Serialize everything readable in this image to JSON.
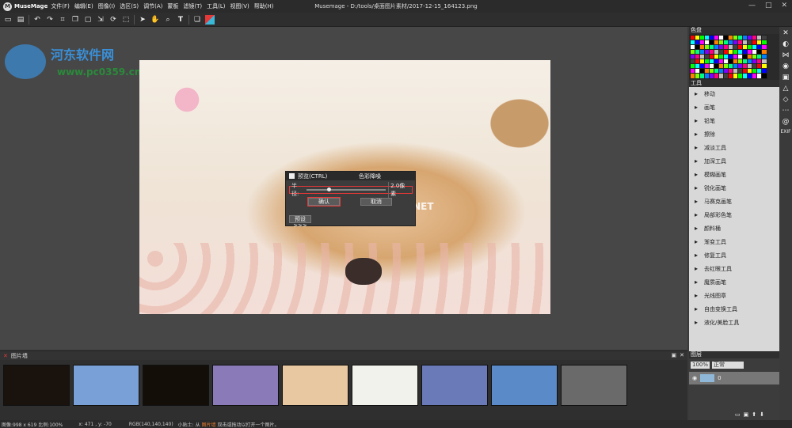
{
  "app": {
    "name": "MuseMage",
    "window_title": "Musemage - D:/tools/桌面图片素材/2017-12-15_164123.png"
  },
  "menu": [
    "文件(F)",
    "编辑(E)",
    "图像(I)",
    "选区(S)",
    "调节(A)",
    "蒙板",
    "滤镜(T)",
    "工具(L)",
    "视图(V)",
    "帮助(H)"
  ],
  "window_buttons": [
    "—",
    "□",
    "✕"
  ],
  "toolbar_icons": [
    "new-icon",
    "open-icon",
    "undo-icon",
    "redo-icon",
    "crop-icon",
    "copy-icon",
    "paste-icon",
    "resize-icon",
    "rotate-icon",
    "select-icon",
    "pointer-icon",
    "hand-icon",
    "zoom-icon",
    "text-icon",
    "layers-icon",
    "color-icon"
  ],
  "watermarks": {
    "site_cn": "河东软件网",
    "site_url": "www.pc0359.cn",
    "photo_mark": "www.pHome.NET"
  },
  "dialog": {
    "preview_label": "预览(CTRL)",
    "title": "色彩降噪",
    "radius_label": "半径:",
    "radius_value": "2.0像素",
    "ok_label": "确认",
    "cancel_label": "取消",
    "preset_label": "预设>>>",
    "slider_fraction": 0.27
  },
  "filmstrip": {
    "title": "图片墙",
    "thumb_colors": [
      "#1a120c",
      "#7aa0d8",
      "#140e08",
      "#8a7ab8",
      "#e8c8a0",
      "#f2f2ec",
      "#6a7ab8",
      "#5a8ac8",
      "#6a6a6a"
    ]
  },
  "status": {
    "size": "图像:998 x 619 比例:100%",
    "coords": "x: 471 , y: -70",
    "rgb": "RGB(140,140,140)",
    "tip_prefix": "小贴士: 从 ",
    "tip_link": "图片墙",
    "tip_suffix": " 双击或拖动以打开一个图片。"
  },
  "panels": {
    "palette_title": "色盘",
    "tools_title": "工具",
    "layers_title": "图层"
  },
  "palette": [
    "#ff0000",
    "#ffff00",
    "#00ff00",
    "#00ffff",
    "#0000ff",
    "#ff00ff",
    "#ffffff",
    "#000000",
    "#ff8000",
    "#80ff00",
    "#00ff80",
    "#0080ff",
    "#8000ff",
    "#ff0080",
    "#c0c0c0",
    "#404040"
  ],
  "tools": [
    {
      "icon": "arrow-icon",
      "label": "移动"
    },
    {
      "icon": "brush-icon",
      "label": "画笔"
    },
    {
      "icon": "pencil-icon",
      "label": "铅笔"
    },
    {
      "icon": "eraser-icon",
      "label": "擦除"
    },
    {
      "icon": "dodge-icon",
      "label": "减淡工具"
    },
    {
      "icon": "burn-icon",
      "label": "加深工具"
    },
    {
      "icon": "blur-icon",
      "label": "模糊画笔"
    },
    {
      "icon": "sharpen-icon",
      "label": "锐化画笔"
    },
    {
      "icon": "mosaic-icon",
      "label": "马赛克画笔"
    },
    {
      "icon": "color-brush-icon",
      "label": "局部彩色笔"
    },
    {
      "icon": "bucket-icon",
      "label": "颜料桶"
    },
    {
      "icon": "gradient-icon",
      "label": "渐变工具"
    },
    {
      "icon": "patch-icon",
      "label": "修复工具"
    },
    {
      "icon": "redeye-icon",
      "label": "去红眼工具"
    },
    {
      "icon": "magic-brush-icon",
      "label": "魔质画笔"
    },
    {
      "icon": "stamp-icon",
      "label": "光线图章"
    },
    {
      "icon": "transform-icon",
      "label": "自由变换工具"
    },
    {
      "icon": "liquify-icon",
      "label": "液化/美脸工具"
    }
  ],
  "side_strip": [
    "✕",
    "◐",
    "⋈",
    "◉",
    "▣",
    "△",
    "◇",
    "⋯",
    "@",
    "EXIF"
  ],
  "layers": {
    "opacity": "100%",
    "blend": "正常",
    "layer_name": "0"
  }
}
